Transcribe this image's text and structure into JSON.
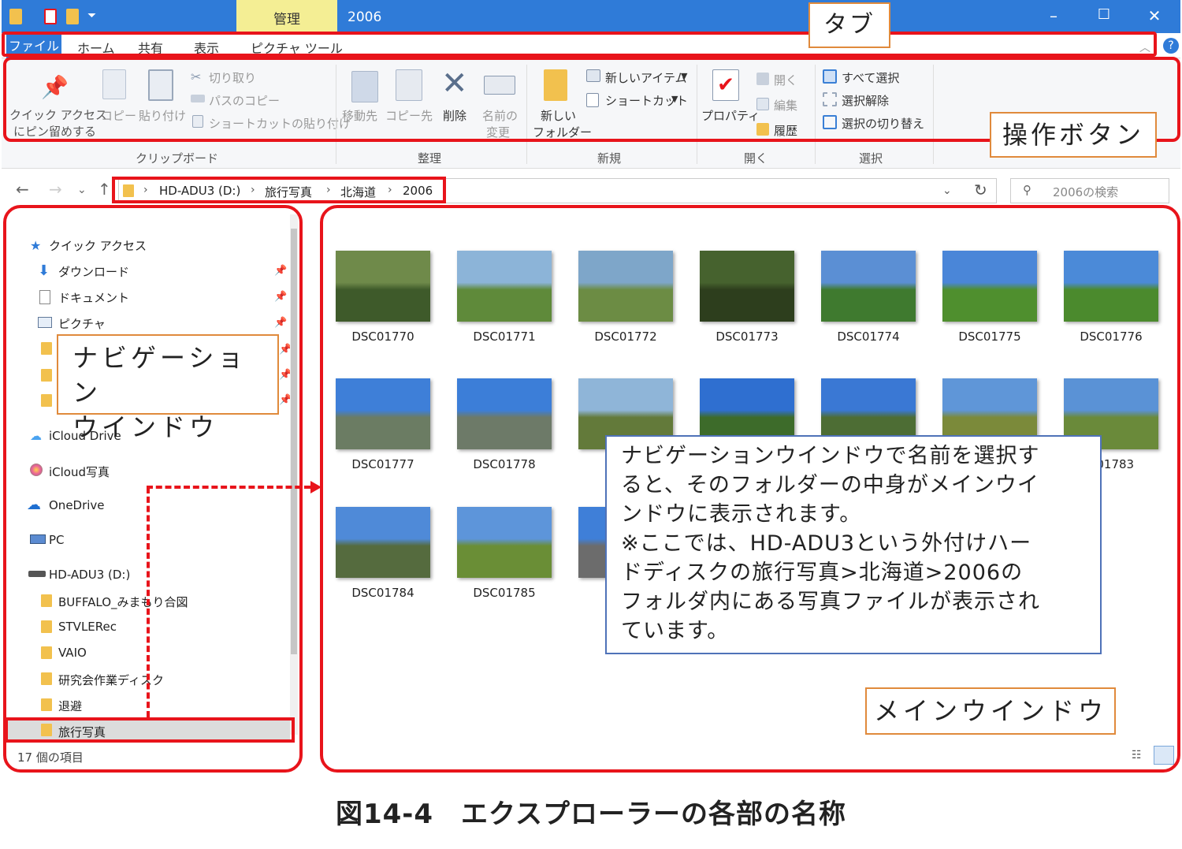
{
  "window": {
    "title": "2006",
    "manage_tab": "管理"
  },
  "tabs": [
    "ファイル",
    "ホーム",
    "共有",
    "表示",
    "ピクチャ ツール"
  ],
  "ribbon": {
    "clipboard": {
      "pin_line1": "クイック アクセス",
      "pin_line2": "にピン留めする",
      "copy": "コピー",
      "paste": "貼り付け",
      "cut": "切り取り",
      "copy_path": "パスのコピー",
      "paste_shortcut": "ショートカットの貼り付け"
    },
    "organize": {
      "move_to": "移動先",
      "copy_to": "コピー先",
      "delete": "削除",
      "rename_line1": "名前の",
      "rename_line2": "変更"
    },
    "new": {
      "new_folder_line1": "新しい",
      "new_folder_line2": "フォルダー",
      "new_item": "新しいアイテム",
      "shortcut": "ショートカット"
    },
    "open": {
      "properties": "プロパティ",
      "open": "開く",
      "edit": "編集",
      "history": "履歴"
    },
    "select": {
      "select_all": "すべて選択",
      "select_none": "選択解除",
      "invert": "選択の切り替え"
    },
    "groups": [
      "クリップボード",
      "整理",
      "新規",
      "開く",
      "選択"
    ]
  },
  "address": {
    "crumbs": [
      "HD-ADU3 (D:)",
      "旅行写真",
      "北海道",
      "2006"
    ],
    "search_placeholder": "2006の検索"
  },
  "nav": {
    "quick_access": "クイック アクセス",
    "items": [
      "ダウンロード",
      "ドキュメント",
      "ピクチャ"
    ],
    "icloud_drive": "iCloud Drive",
    "icloud_photos": "iCloud写真",
    "onedrive": "OneDrive",
    "pc": "PC",
    "drive": "HD-ADU3 (D:)",
    "folders": [
      "BUFFALO_みまもり合図",
      "STVLERec",
      "VAIO",
      "研究会作業ディスク",
      "退避",
      "旅行写真"
    ]
  },
  "status": "17 個の項目",
  "files": [
    "DSC01770",
    "DSC01771",
    "DSC01772",
    "DSC01773",
    "DSC01774",
    "DSC01775",
    "DSC01776",
    "DSC01777",
    "DSC01778",
    "D",
    "",
    "",
    "",
    "C01783",
    "DSC01784",
    "DSC01785",
    "D"
  ],
  "annotations": {
    "tab": "タブ",
    "buttons": "操作ボタン",
    "nav_line1": "ナビゲーション",
    "nav_line2": "ウインドウ",
    "main": "メインウインドウ",
    "info_lines": [
      "ナビゲーションウインドウで名前を選択す",
      "ると、そのフォルダーの中身がメインウイ",
      "ンドウに表示されます。",
      "※ここでは、HD-ADU3という外付けハー",
      "ドディスクの旅行写真>北海道>2006の",
      "フォルダ内にある写真ファイルが表示され",
      "ています。"
    ]
  },
  "caption": "図14-4　エクスプローラーの各部の名称",
  "colors": {
    "titlebar": "#2f7bd8",
    "manage": "#f4ee94",
    "highlight": "#e8141b",
    "callout_border": "#e08a3c",
    "info_border": "#4f72b8"
  }
}
